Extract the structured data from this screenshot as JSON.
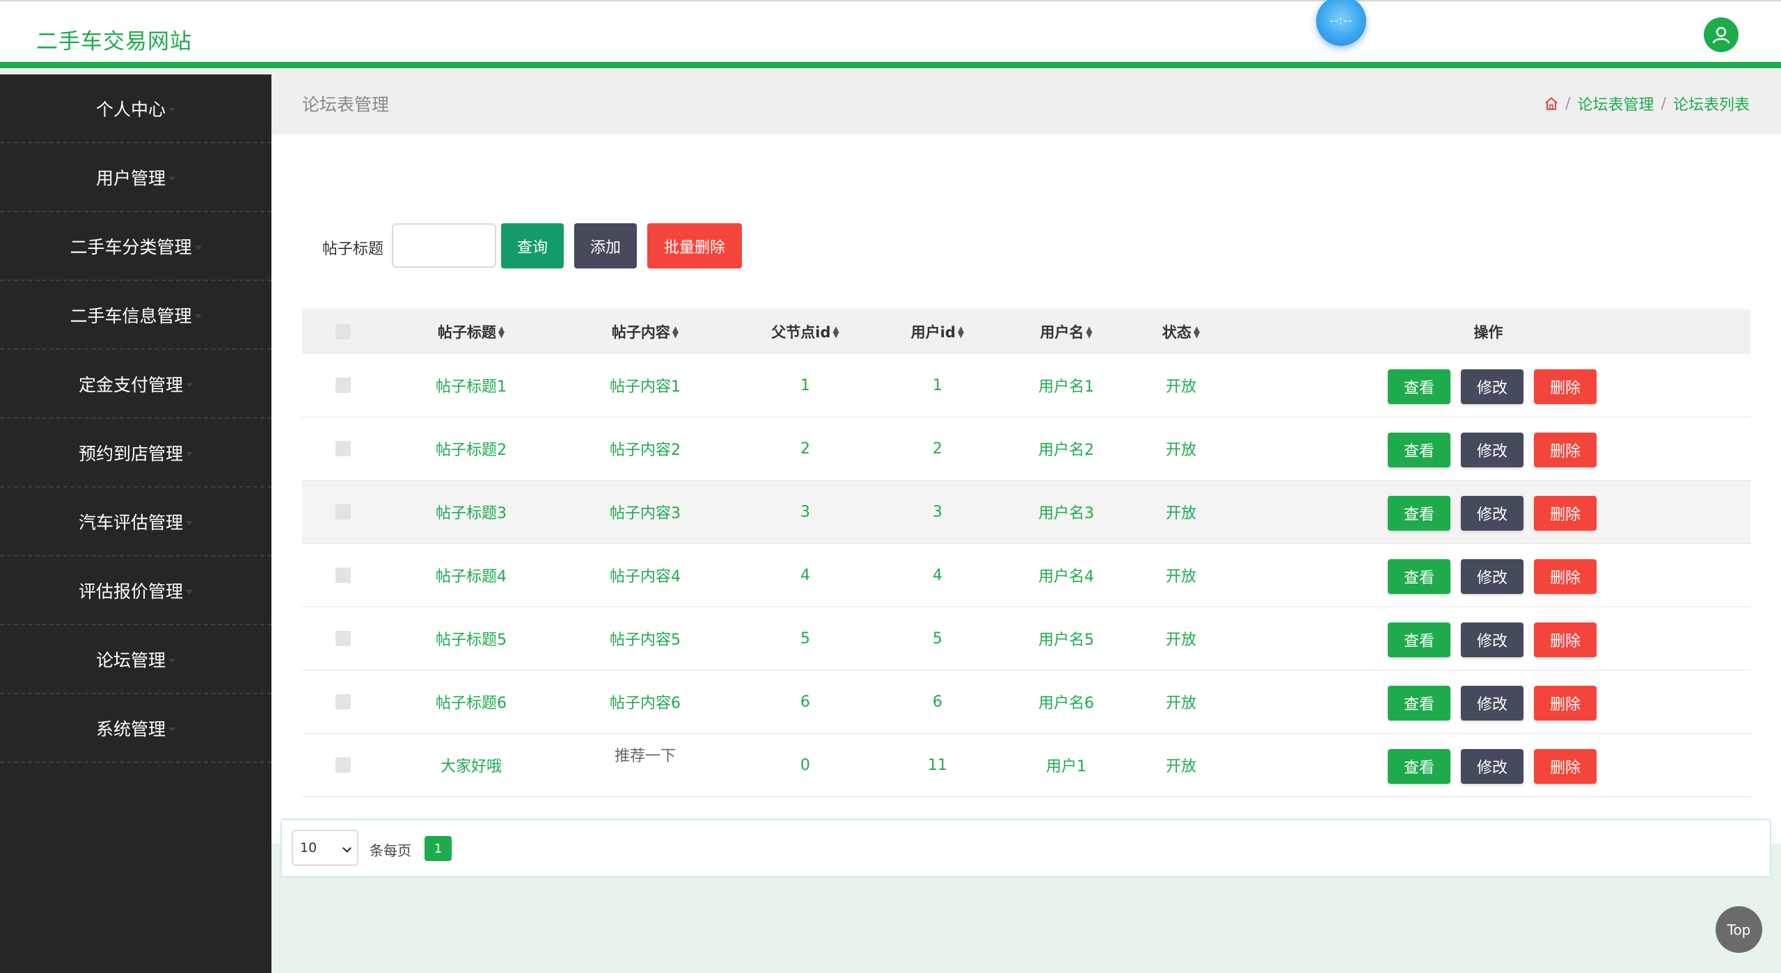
{
  "header": {
    "site_title": "二手车交易网站",
    "clock_text": "--:--"
  },
  "sidebar": {
    "items": [
      {
        "label": "个人中心"
      },
      {
        "label": "用户管理"
      },
      {
        "label": "二手车分类管理"
      },
      {
        "label": "二手车信息管理"
      },
      {
        "label": "定金支付管理"
      },
      {
        "label": "预约到店管理"
      },
      {
        "label": "汽车评估管理"
      },
      {
        "label": "评估报价管理"
      },
      {
        "label": "论坛管理"
      },
      {
        "label": "系统管理"
      }
    ]
  },
  "page": {
    "title": "论坛表管理",
    "breadcrumb": [
      "论坛表管理",
      "论坛表列表"
    ]
  },
  "search": {
    "label": "帖子标题",
    "value": "",
    "query_label": "查询",
    "add_label": "添加",
    "batch_delete_label": "批量删除"
  },
  "table": {
    "columns": [
      "帖子标题",
      "帖子内容",
      "父节点id",
      "用户id",
      "用户名",
      "状态",
      "操作"
    ],
    "rows": [
      {
        "title": "帖子标题1",
        "content": "帖子内容1",
        "parent_id": "1",
        "user_id": "1",
        "username": "用户名1",
        "status": "开放"
      },
      {
        "title": "帖子标题2",
        "content": "帖子内容2",
        "parent_id": "2",
        "user_id": "2",
        "username": "用户名2",
        "status": "开放"
      },
      {
        "title": "帖子标题3",
        "content": "帖子内容3",
        "parent_id": "3",
        "user_id": "3",
        "username": "用户名3",
        "status": "开放"
      },
      {
        "title": "帖子标题4",
        "content": "帖子内容4",
        "parent_id": "4",
        "user_id": "4",
        "username": "用户名4",
        "status": "开放"
      },
      {
        "title": "帖子标题5",
        "content": "帖子内容5",
        "parent_id": "5",
        "user_id": "5",
        "username": "用户名5",
        "status": "开放"
      },
      {
        "title": "帖子标题6",
        "content": "帖子内容6",
        "parent_id": "6",
        "user_id": "6",
        "username": "用户名6",
        "status": "开放"
      },
      {
        "title": "大家好哦",
        "content": "推荐一下",
        "parent_id": "0",
        "user_id": "11",
        "username": "用户1",
        "status": "开放"
      }
    ],
    "actions": {
      "view": "查看",
      "edit": "修改",
      "delete": "删除"
    }
  },
  "pagination": {
    "page_size": "10",
    "per_page_label": "条每页",
    "current_page": "1"
  },
  "back_to_top": "Top",
  "colors": {
    "brand_green": "#1eab4c",
    "query_green": "#149c68",
    "dark_slate": "#454a5c",
    "danger_red": "#f3453b",
    "sidebar_bg": "#262626"
  }
}
